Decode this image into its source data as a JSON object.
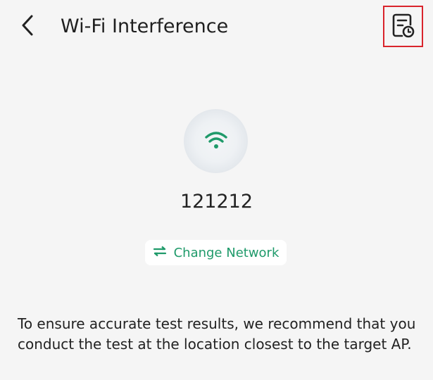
{
  "header": {
    "title": "Wi-Fi Interference",
    "back_icon": "chevron-left-icon",
    "history_icon": "document-clock-icon"
  },
  "main": {
    "wifi_icon": "wifi-icon",
    "network_name": "121212",
    "change_network_label": "Change Network",
    "change_network_icon": "swap-arrows-icon",
    "note": "To ensure accurate test results, we recommend that you conduct the test at the location closest to the target AP."
  },
  "colors": {
    "accent": "#1f9a6a",
    "highlight_border": "#d9242c",
    "background": "#f5f5f5"
  }
}
